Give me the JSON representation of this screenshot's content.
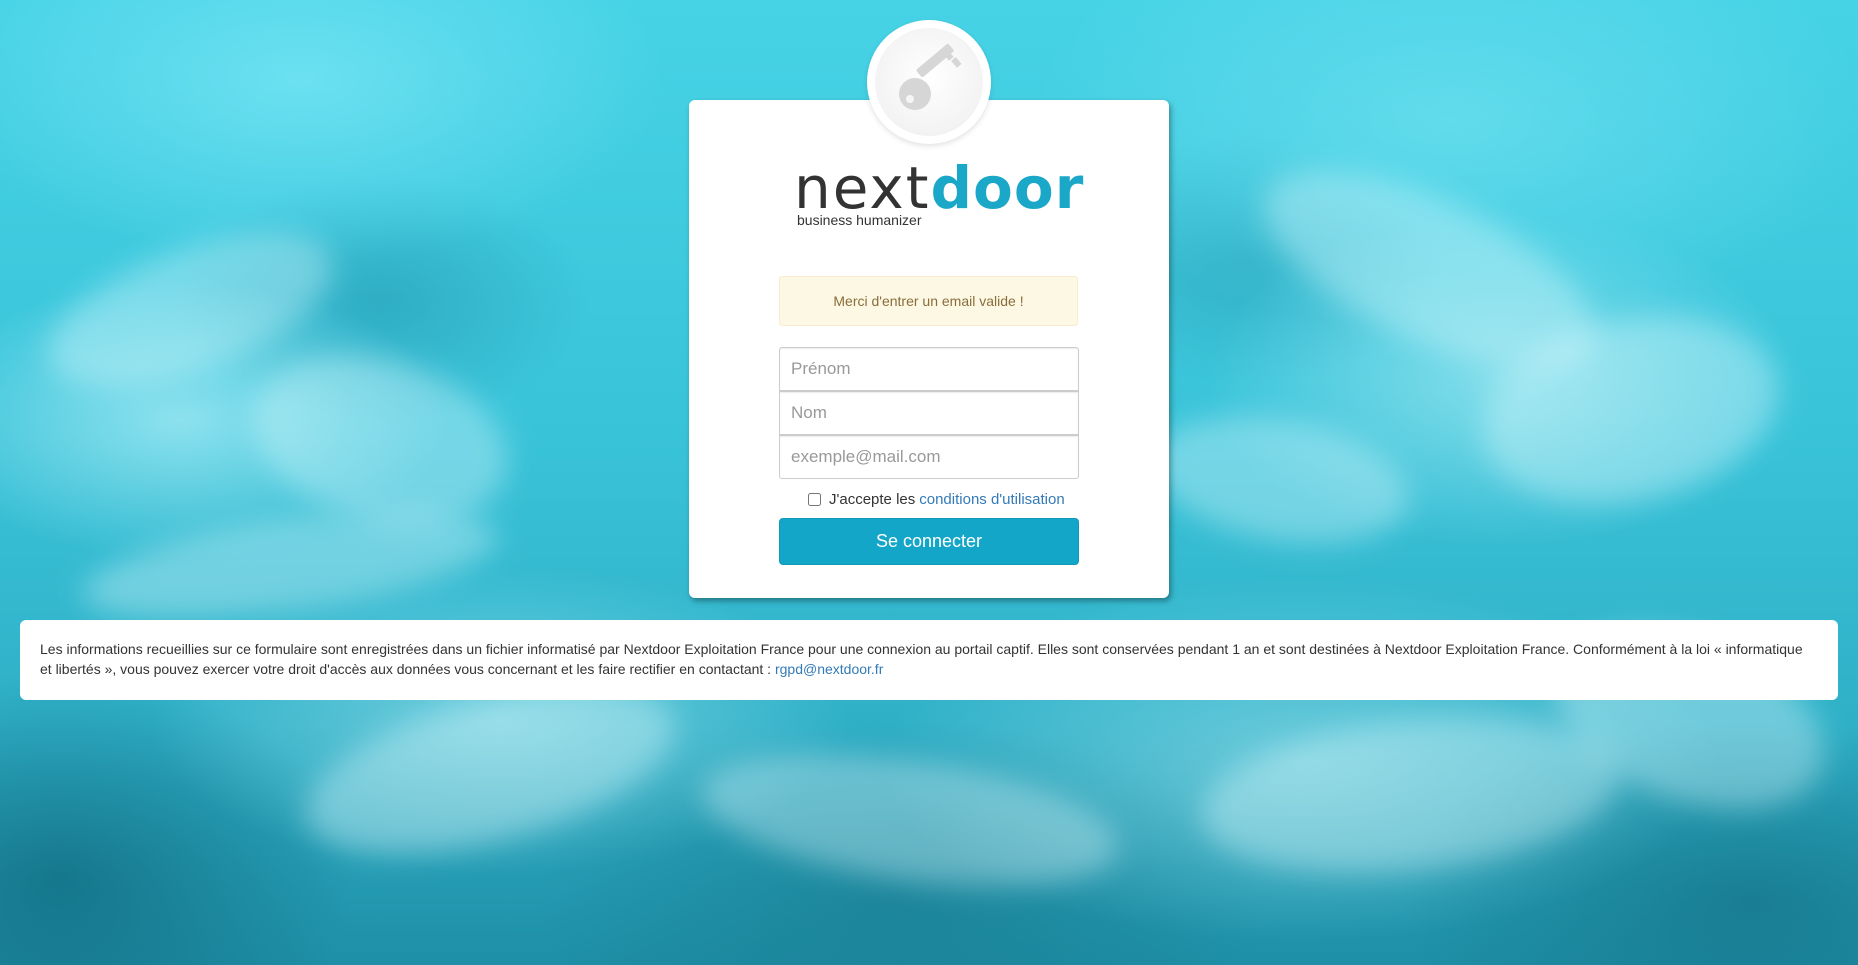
{
  "brand": {
    "name_part1": "next",
    "name_part2": "door",
    "tagline": "business humanizer",
    "accent_color": "#1ba8c8"
  },
  "badge": {
    "icon": "key-icon"
  },
  "alert": {
    "message": "Merci d'entrer un email valide !",
    "type": "warning"
  },
  "form": {
    "first_name": {
      "placeholder": "Prénom",
      "value": ""
    },
    "last_name": {
      "placeholder": "Nom",
      "value": ""
    },
    "email": {
      "placeholder": "exemple@mail.com",
      "value": ""
    },
    "terms": {
      "checked": false,
      "label_prefix": "J'accepte les",
      "link_text": "conditions d'utilisation"
    },
    "submit_label": "Se connecter"
  },
  "notice": {
    "text": "Les informations recueillies sur ce formulaire sont enregistrées dans un fichier informatisé par Nextdoor Exploitation France pour une connexion au portail captif. Elles sont conservées pendant 1 an et sont destinées à Nextdoor Exploitation France. Conformément à la loi « informatique et libertés », vous pouvez exercer votre droit d'accès aux données vous concernant et les faire rectifier en contactant :",
    "contact_email": "rgpd@nextdoor.fr"
  }
}
